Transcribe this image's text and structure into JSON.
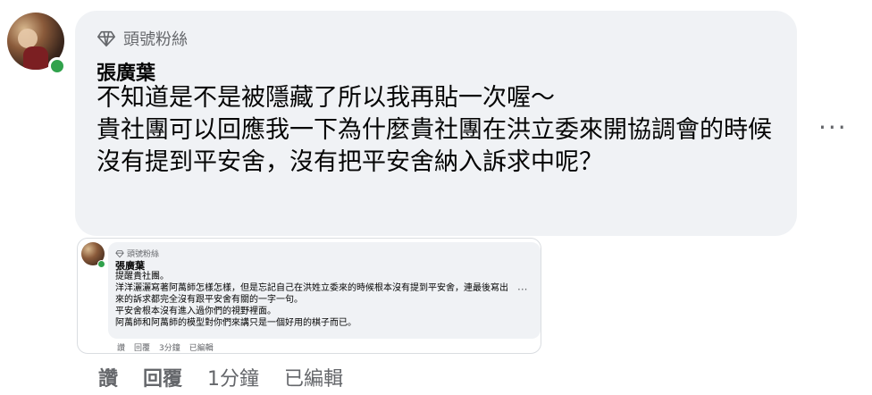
{
  "comment": {
    "badge": "頭號粉絲",
    "author": "張廣葉",
    "text": "不知道是不是被隱藏了所以我再貼一次喔～\n貴社團可以回應我一下為什麼貴社團在洪立委來開協調會的時候沒有提到平安舍，沒有把平安舍納入訴求中呢？",
    "more": "···"
  },
  "shared_comment": {
    "badge": "頭號粉絲",
    "author": "張廣葉",
    "text": "提醒貴社團。\n洋洋灑灑寫著阿萬師怎樣怎樣，但是忘記自己在洪姓立委來的時候根本沒有提到平安舍，連最後寫出來的訴求都完全沒有跟平安舍有關的一字一句。\n平安舍根本沒有進入過你們的視野裡面。\n阿萬師和阿萬師的模型對你們來講只是一個好用的棋子而已。",
    "more": "···",
    "actions": {
      "like": "讚",
      "reply": "回覆",
      "time": "3分鐘",
      "edited": "已編輯"
    }
  },
  "actions": {
    "like": "讚",
    "reply": "回覆",
    "time": "1分鐘",
    "edited": "已編輯"
  },
  "colors": {
    "bubble": "#f0f2f5",
    "online": "#31a24c",
    "secondary_text": "#65676b"
  }
}
